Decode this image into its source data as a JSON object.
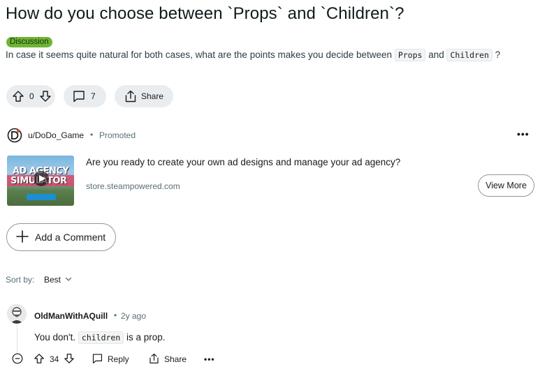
{
  "post": {
    "title": "How do you choose between `Props` and `Children`?",
    "flair": "Discussion",
    "body_before": "In case it seems quite natural for both cases, what are the points makes you decide between ",
    "code1": "Props",
    "body_mid": " and ",
    "code2": "Children",
    "body_after": " ?",
    "votes": "0",
    "comments": "7",
    "share_label": "Share"
  },
  "ad": {
    "username": "u/DoDo_Game",
    "separator": "•",
    "promoted": "Promoted",
    "more": "•••",
    "thumb_line1": "AD AGENCY",
    "thumb_line2": "SIMULATOR",
    "headline": "Are you ready to create your own ad designs and manage your ad agency?",
    "domain": "store.steampowered.com",
    "cta": "View More"
  },
  "composer": {
    "add_comment_label": "Add a Comment"
  },
  "sort": {
    "label": "Sort by:",
    "value": "Best"
  },
  "comment": {
    "author": "OldManWithAQuill",
    "separator": "•",
    "time": "2y ago",
    "body_before": "You don't. ",
    "code": "children",
    "body_after": " is a prop.",
    "votes": "34",
    "reply_label": "Reply",
    "share_label": "Share",
    "more": "•••"
  },
  "colors": {
    "flair_bg": "#6cb535",
    "pill_bg": "#eaedef",
    "meta_text": "#576f76"
  }
}
